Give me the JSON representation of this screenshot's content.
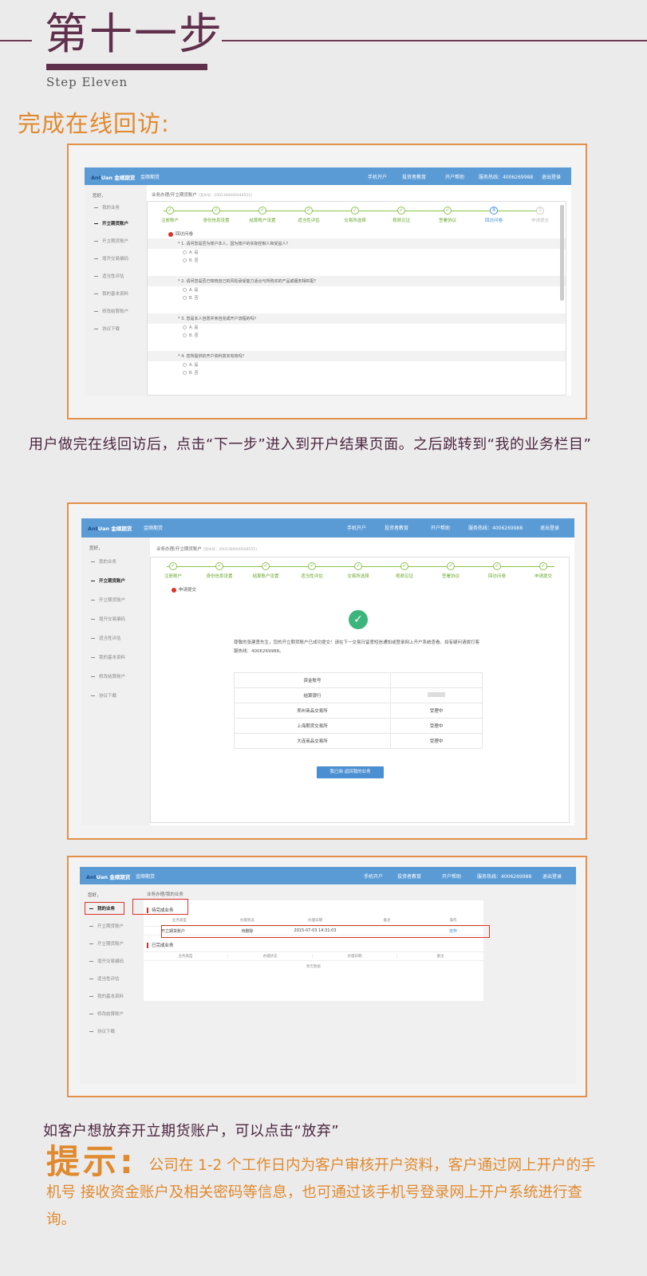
{
  "header": {
    "title": "第十一步",
    "subtitle": "Step Eleven"
  },
  "section_title": "完成在线回访:",
  "paragraph1": "用户做完在线回访后，点击“下一步”进入到开户结果页面。之后跳转到“我的业务栏目”",
  "paragraph2": "如客户想放弃开立期货账户，可以点击“放弃”",
  "tip": {
    "label": "提示:",
    "text": "公司在 1-2 个工作日内为客户审核开户资料，客户通过网上开户的手机号 接收资金账户及相关密码等信息，也可通过该手机号登录网上开户系统进行查询。"
  },
  "app": {
    "logo_a": "Ant",
    "logo_b": "Uan 金顺期货",
    "nav": "金顺期货",
    "top_links": [
      "手机开户",
      "投资者教育",
      "开户帮助",
      "服务热线：4006269988",
      "退出登录"
    ],
    "greeting": "您好，",
    "sidebar": [
      "我的业务",
      "开立期货账户",
      "开立期货账户",
      "增开交易编码",
      "适当性评估",
      "我的基本资料",
      "修改结算账户",
      "协议下载"
    ],
    "crumb": "业务办理/开立期货账户",
    "crumb_no": "[流水号：2001300000048555]",
    "steps": [
      "注册账户",
      "身份信息设置",
      "结算账户设置",
      "适当性评估",
      "交易所选择",
      "视频见证",
      "签署协议",
      "回访问卷",
      "申请提交"
    ]
  },
  "shot1": {
    "section_label": "回访问卷",
    "questions": [
      {
        "q": "* 1. 请问您是否为账户本人，因为账户的实际控制人和受益人？",
        "opts": [
          "A. 是",
          "B. 否"
        ]
      },
      {
        "q": "* 2. 请问您是否已知晓自己的风险承受能力适合与所购买的产品或服务相匹配？",
        "opts": [
          "A. 是",
          "B. 否"
        ]
      },
      {
        "q": "* 3. 您是本人自愿并亲自完成开户流程的吗？",
        "opts": [
          "A. 是",
          "B. 否"
        ]
      },
      {
        "q": "* 4. 您所提供的开户资料真实有效吗？",
        "opts": [
          "A. 是",
          "B. 否"
        ]
      }
    ]
  },
  "shot2": {
    "section_label": "申请提交",
    "message": "尊敬的张建勇先生，您的开立期货账户已成功提交！请在下一交易日留意短信通知或登录网上开户系统查看。如有疑问请拨打客服热线：4006269988。",
    "table": [
      [
        "资金账号",
        ""
      ],
      [
        "结算银行",
        ""
      ],
      [
        "郑州商品交易所",
        "受理中"
      ],
      [
        "上海期货交易所",
        "受理中"
      ],
      [
        "大连商品交易所",
        "受理中"
      ]
    ],
    "button": "我已阅 返回我的业务"
  },
  "shot3": {
    "crumb": "业务办理/我的业务",
    "sidebar_active": "我的业务",
    "pending_title": "待完成业务",
    "pending_headers": [
      "业务类型",
      "办理状态",
      "办理日期",
      "备注",
      "操作"
    ],
    "pending_row": [
      "开立期货账户",
      "待删除",
      "2015-07-03 14:31:03",
      "",
      "放弃"
    ],
    "done_title": "已完成业务",
    "done_headers": [
      "业务类型",
      "办理状态",
      "办理日期",
      "备注"
    ],
    "done_empty": "暂无数据"
  },
  "colors": {
    "accent": "#e08a2f",
    "title": "#5f2f4c",
    "app_bar": "#5b9bd5",
    "step_done": "#8bc34a",
    "success": "#3bb57b",
    "highlight": "#d9342b"
  }
}
